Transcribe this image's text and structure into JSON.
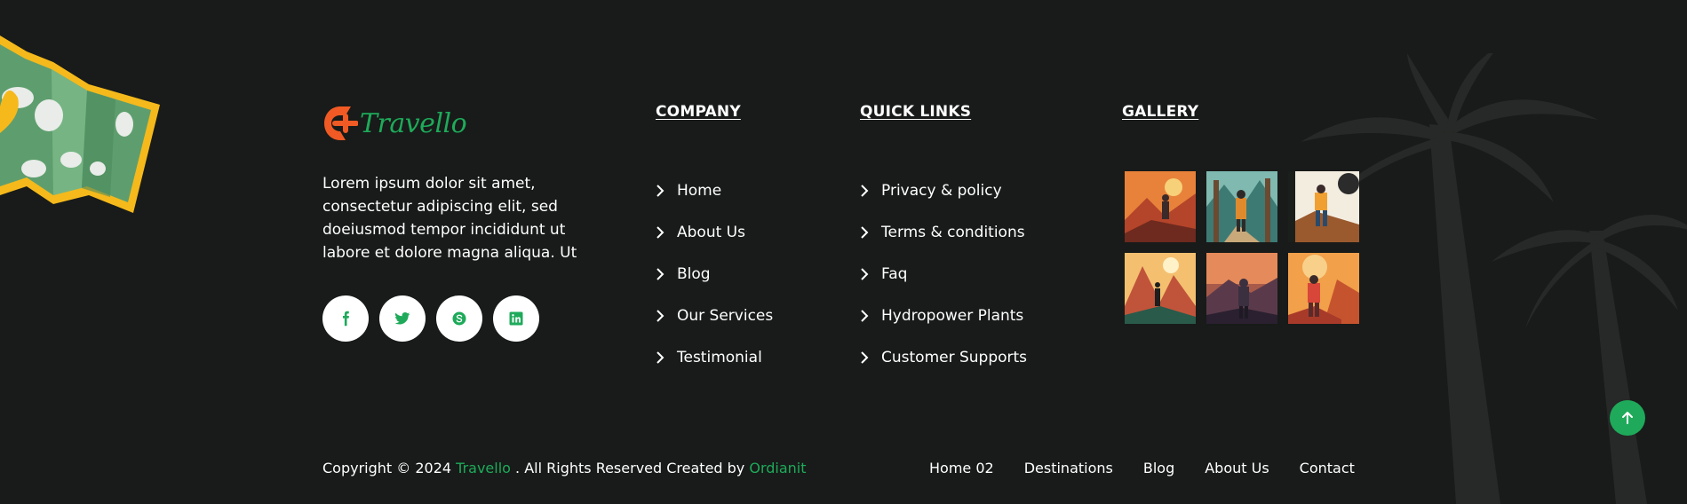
{
  "brand": {
    "name": "Travello",
    "accent_color": "#1eaa5a",
    "logo_color": "#f15a24"
  },
  "about": {
    "text": "Lorem ipsum dolor sit amet, consectetur adipiscing elit, sed doeiusmod tempor incididunt ut labore et dolore magna aliqua. Ut"
  },
  "socials": [
    {
      "icon": "facebook-icon"
    },
    {
      "icon": "twitter-icon"
    },
    {
      "icon": "skype-icon"
    },
    {
      "icon": "linkedin-icon"
    }
  ],
  "company": {
    "heading": "COMPANY",
    "links": [
      "Home",
      "About Us",
      "Blog",
      "Our Services",
      "Testimonial"
    ]
  },
  "quick_links": {
    "heading": "QUICK LINKS",
    "links": [
      "Privacy & policy",
      "Terms & conditions",
      "Faq",
      "Hydropower Plants",
      "Customer Supports"
    ]
  },
  "gallery": {
    "heading": "GALLERY",
    "images": [
      "hiker-autumn-image",
      "hiker-forest-image",
      "hiker-sunset-image",
      "hiker-mountains-image",
      "hiker-dusk-image",
      "hiker-orange-image"
    ]
  },
  "footer": {
    "copyright_prefix": "Copyright © 2024 ",
    "brand_link": "Travello",
    "copyright_middle": " . All Rights Reserved Created by ",
    "creator_link": "Ordianit",
    "nav": [
      "Home 02",
      "Destinations",
      "Blog",
      "About Us",
      "Contact"
    ]
  },
  "back_to_top": {
    "icon": "arrow-up-icon"
  },
  "colors": {
    "background": "#181b19",
    "accent": "#1eaa5a",
    "text": "#ffffff"
  }
}
